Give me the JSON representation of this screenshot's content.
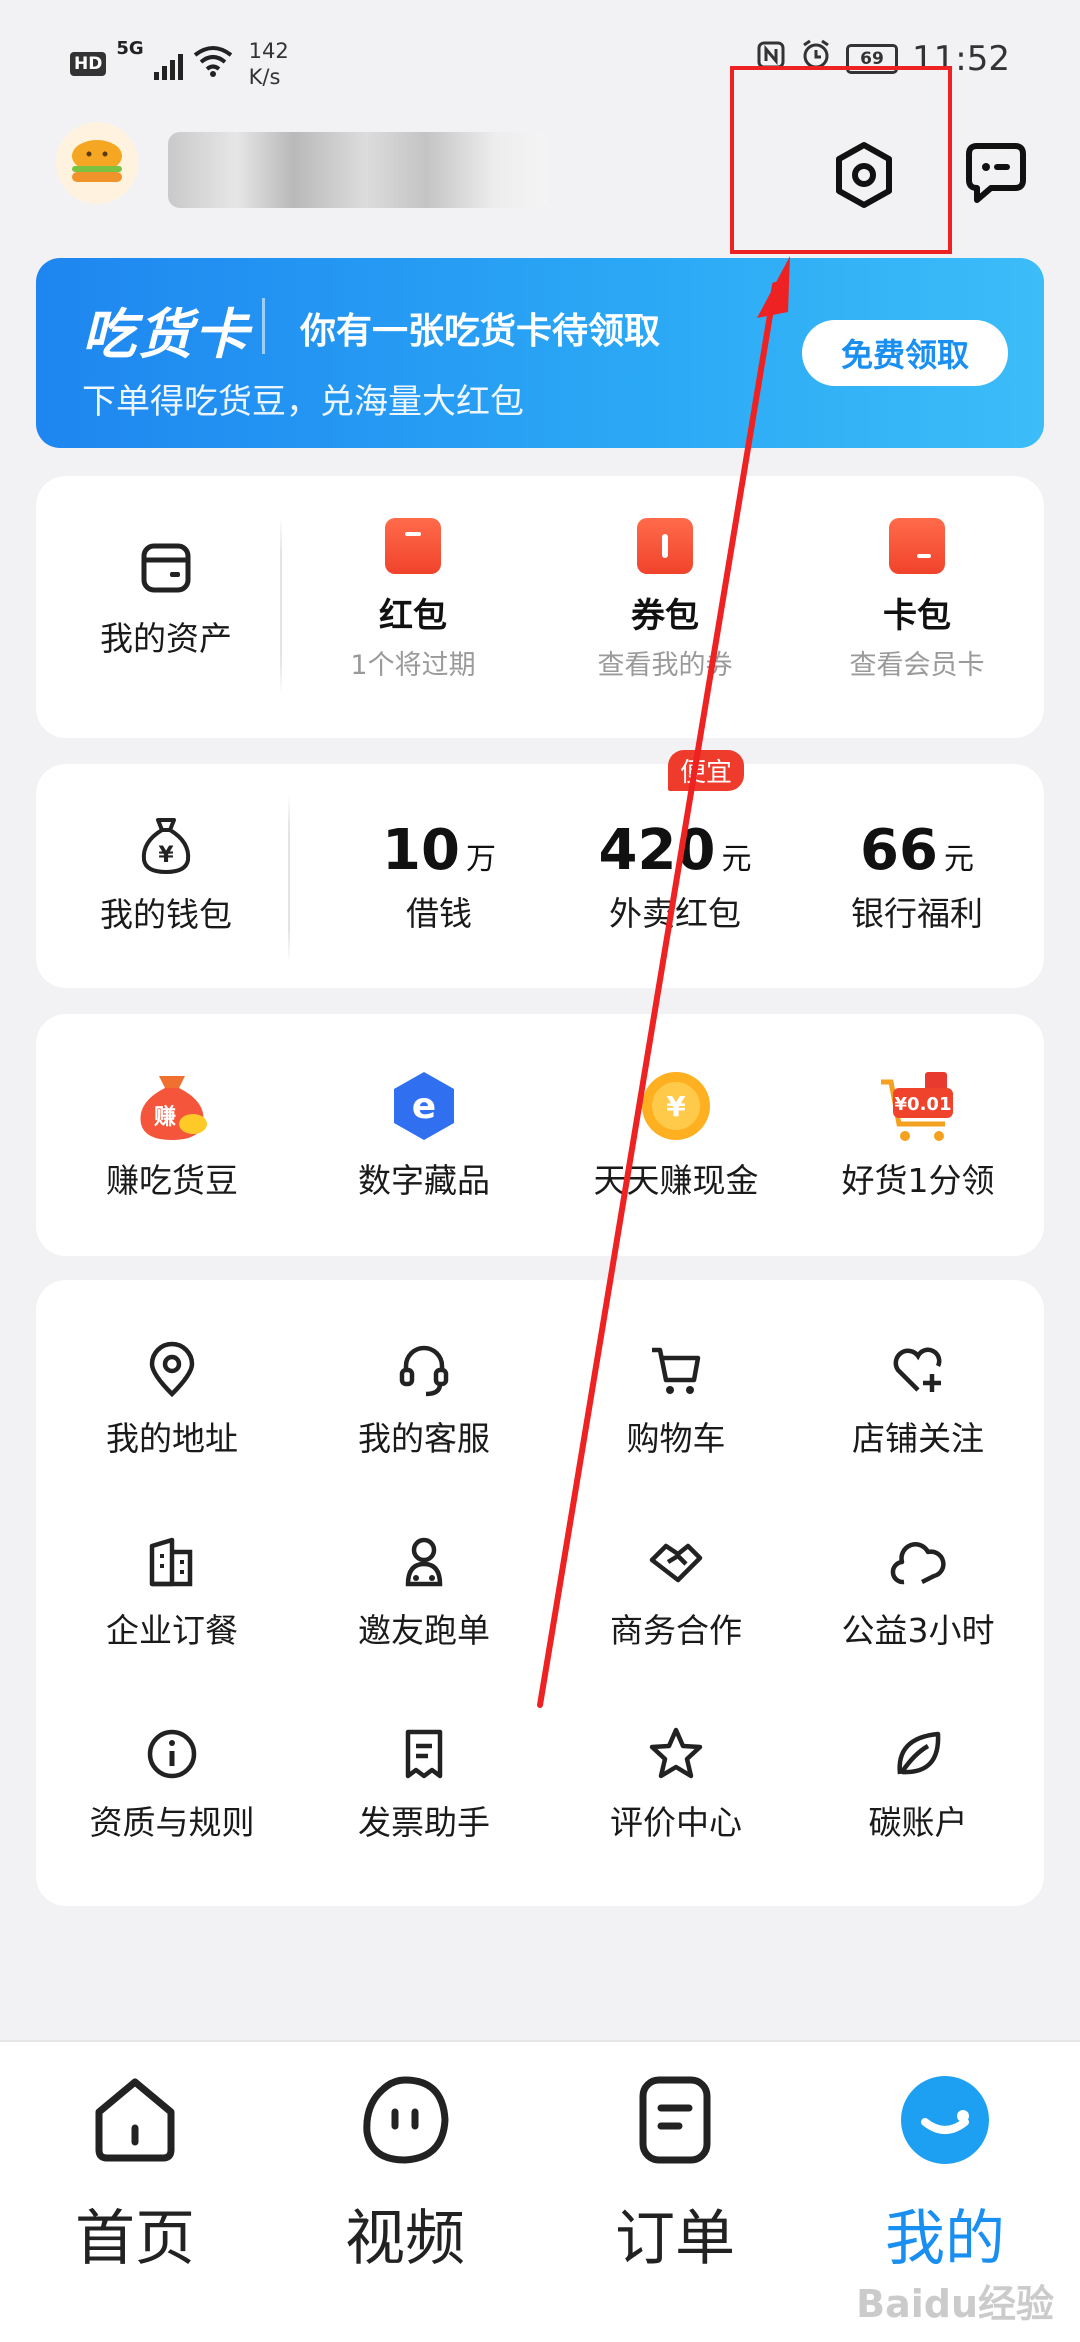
{
  "status_bar": {
    "hd": "HD",
    "network": "5G",
    "speed_value": "142",
    "speed_unit": "K/s",
    "battery": "69",
    "time": "11:52"
  },
  "header": {
    "settings_icon": "settings-hexagon-icon",
    "message_icon": "chat-bubble-icon"
  },
  "banner": {
    "brand": "吃货卡",
    "title": "你有一张吃货卡待领取",
    "subtitle": "下单得吃货豆，兑海量大红包",
    "button": "免费领取"
  },
  "assets": {
    "main_label": "我的资产",
    "items": [
      {
        "title": "红包",
        "sub": "1个将过期"
      },
      {
        "title": "券包",
        "sub": "查看我的券"
      },
      {
        "title": "卡包",
        "sub": "查看会员卡"
      }
    ]
  },
  "wallet": {
    "main_label": "我的钱包",
    "badge": "便宜",
    "items": [
      {
        "value": "10",
        "unit": "万",
        "label": "借钱"
      },
      {
        "value": "420",
        "unit": "元",
        "label": "外卖红包"
      },
      {
        "value": "66",
        "unit": "元",
        "label": "银行福利"
      }
    ]
  },
  "promos": {
    "items": [
      {
        "label": "赚吃货豆",
        "badge": "赚"
      },
      {
        "label": "数字藏品",
        "badge": "e"
      },
      {
        "label": "天天赚现金",
        "badge": "¥"
      },
      {
        "label": "好货1分领",
        "badge": "¥0.01"
      }
    ]
  },
  "services": {
    "items": [
      {
        "label": "我的地址",
        "icon": "location-pin-icon"
      },
      {
        "label": "我的客服",
        "icon": "headset-icon"
      },
      {
        "label": "购物车",
        "icon": "cart-icon"
      },
      {
        "label": "店铺关注",
        "icon": "heart-plus-icon"
      },
      {
        "label": "企业订餐",
        "icon": "building-icon"
      },
      {
        "label": "邀友跑单",
        "icon": "rider-icon"
      },
      {
        "label": "商务合作",
        "icon": "handshake-icon"
      },
      {
        "label": "公益3小时",
        "icon": "cloud-icon"
      },
      {
        "label": "资质与规则",
        "icon": "info-icon"
      },
      {
        "label": "发票助手",
        "icon": "invoice-icon"
      },
      {
        "label": "评价中心",
        "icon": "star-icon"
      },
      {
        "label": "碳账户",
        "icon": "leaf-icon"
      }
    ]
  },
  "bottom_nav": {
    "items": [
      {
        "label": "首页",
        "icon": "home-icon"
      },
      {
        "label": "视频",
        "icon": "video-face-icon"
      },
      {
        "label": "订单",
        "icon": "order-icon"
      },
      {
        "label": "我的",
        "icon": "profile-icon"
      }
    ]
  },
  "watermark": "Baidu经验",
  "colors": {
    "accent": "#1a8ff2",
    "annotation_red": "#ee2222",
    "promo_red": "#f0432b"
  }
}
